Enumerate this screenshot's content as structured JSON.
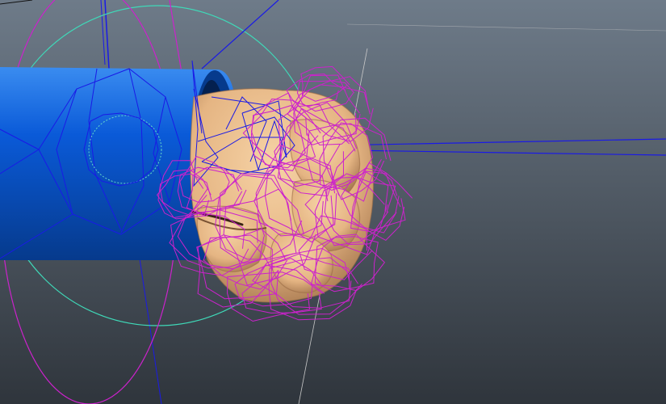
{
  "viewport": {
    "background_top": "#6e7b89",
    "background_bottom": "#2f353c"
  },
  "colors": {
    "sleeve_light": "#3a8cf0",
    "sleeve_mid": "#0a5ad8",
    "sleeve_dark": "#063a8c",
    "skin_light": "#f6d3a6",
    "skin_mid": "#e5b583",
    "skin_dark": "#9b6d46",
    "joint_wire": "#1a1ae6",
    "finger_control": "#cc22cc",
    "rotate_ring": "#3fd9b8",
    "guide_line": "#c8c8c8",
    "wrist_ring": "#66d9c9"
  },
  "icons": {
    "sleeve": "cylinder-sleeve-mesh",
    "hand": "clenched-fist-mesh",
    "controls": "nurbs-control-curves"
  }
}
